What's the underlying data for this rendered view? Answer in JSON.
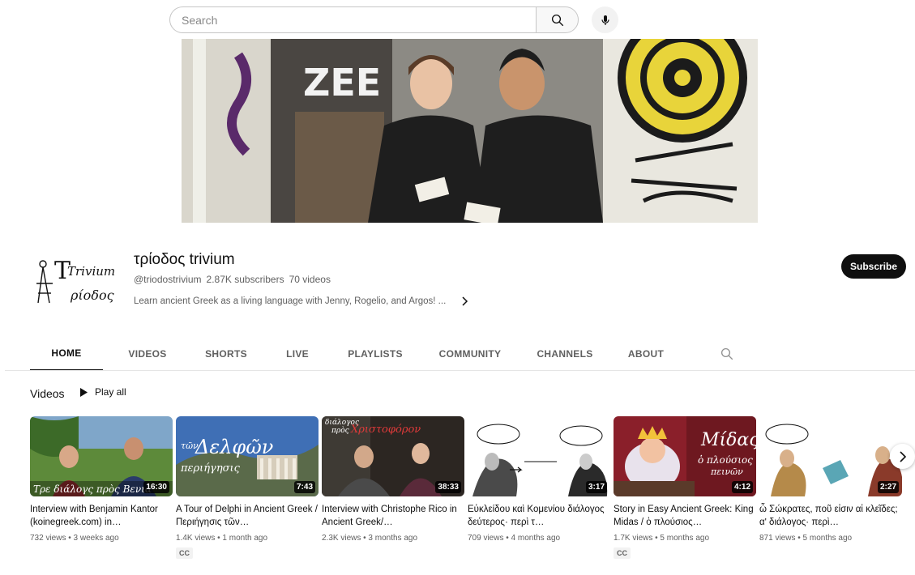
{
  "search": {
    "placeholder": "Search"
  },
  "channel": {
    "name": "τρίοδος trivium",
    "handle": "@triodostrivium",
    "subscribers": "2.87K subscribers",
    "videos": "70 videos",
    "description": "Learn ancient Greek as a living language with Jenny, Rogelio, and Argos! ...",
    "subscribe_label": "Subscribe",
    "avatar_text_top": "Τrivium",
    "avatar_text_bottom": "ρίοδος"
  },
  "tabs": [
    {
      "label": "HOME",
      "active": true
    },
    {
      "label": "VIDEOS",
      "active": false
    },
    {
      "label": "SHORTS",
      "active": false
    },
    {
      "label": "LIVE",
      "active": false
    },
    {
      "label": "PLAYLISTS",
      "active": false
    },
    {
      "label": "COMMUNITY",
      "active": false
    },
    {
      "label": "CHANNELS",
      "active": false
    },
    {
      "label": "ABOUT",
      "active": false
    }
  ],
  "section": {
    "title": "Videos",
    "play_all": "Play all"
  },
  "videos": [
    {
      "title": "Interview with Benjamin Kantor (koinegreek.com) in…",
      "duration": "16:30",
      "meta": "732 views • 3 weeks ago",
      "cc": "",
      "thumb_text": "Τρε διάλογς πρὸς Βενια"
    },
    {
      "title": "A Tour of Delphi in Ancient Greek / Περιήγησις τῶν…",
      "duration": "7:43",
      "meta": "1.4K views • 1 month ago",
      "cc": "CC",
      "thumb_text_1": "τῶν",
      "thumb_text_2": "Δελφῶν",
      "thumb_text_3": "περιήγησις"
    },
    {
      "title": "Interview with Christophe Rico in Ancient Greek/…",
      "duration": "38:33",
      "meta": "2.3K views • 3 months ago",
      "cc": "",
      "thumb_text_1": "διάλογος",
      "thumb_text_2": "πρὸς",
      "thumb_text_3": "Χριστοφόρον"
    },
    {
      "title": "Εὐκλείδου καὶ Κομενίου διάλογος δεύτερος· περὶ τ…",
      "duration": "3:17",
      "meta": "709 views • 4 months ago",
      "cc": "",
      "thumb_text": ""
    },
    {
      "title": "Story in Easy Ancient Greek: King Midas / ὁ πλούσιος…",
      "duration": "4:12",
      "meta": "1.7K views • 5 months ago",
      "cc": "CC",
      "thumb_text_1": "Μίδας",
      "thumb_text_2": "ὁ πλούσιος",
      "thumb_text_3": "πεινῶν"
    },
    {
      "title": "ὦ Σώκρατες, ποῦ εἰσιν αἱ κλεῖδες; αʹ διάλογος· περὶ…",
      "duration": "2:27",
      "meta": "871 views • 5 months ago",
      "cc": "",
      "thumb_text": ""
    }
  ],
  "colors": {
    "subscribe_bg": "#0f0f0f",
    "dart_yellow": "#e8d43a",
    "text_secondary": "#606060"
  }
}
